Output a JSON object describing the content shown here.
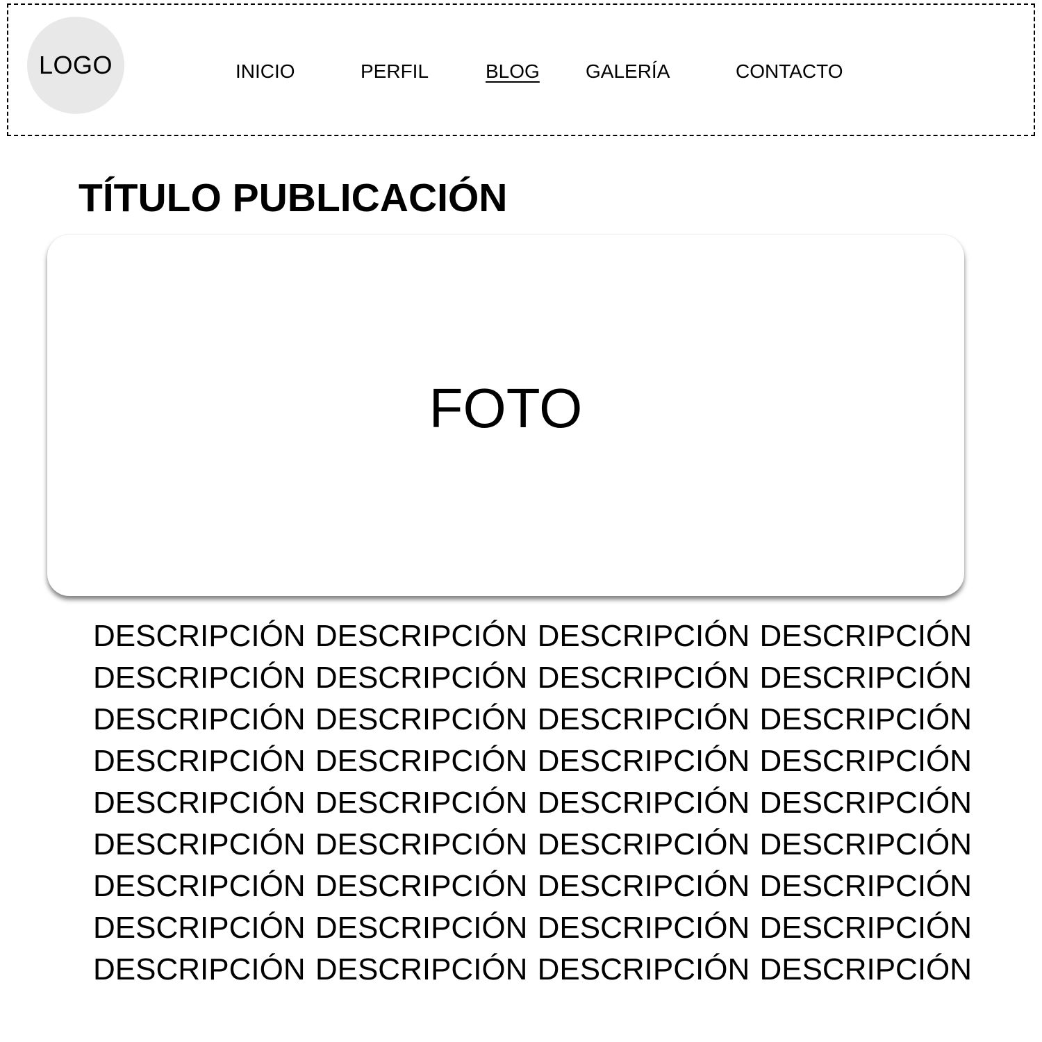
{
  "header": {
    "logo_text": "LOGO",
    "nav": [
      {
        "label": "INICIO",
        "active": false
      },
      {
        "label": "PERFIL",
        "active": false
      },
      {
        "label": "BLOG",
        "active": true
      },
      {
        "label": "GALERÍA",
        "active": false
      },
      {
        "label": "CONTACTO",
        "active": false
      }
    ]
  },
  "post": {
    "title": "TÍTULO PUBLICACIÓN",
    "photo_label": "FOTO",
    "description_lines": [
      "DESCRIPCIÓN DESCRIPCIÓN DESCRIPCIÓN DESCRIPCIÓN",
      "DESCRIPCIÓN DESCRIPCIÓN DESCRIPCIÓN DESCRIPCIÓN",
      "DESCRIPCIÓN DESCRIPCIÓN DESCRIPCIÓN DESCRIPCIÓN",
      "DESCRIPCIÓN DESCRIPCIÓN DESCRIPCIÓN DESCRIPCIÓN",
      "DESCRIPCIÓN DESCRIPCIÓN DESCRIPCIÓN DESCRIPCIÓN",
      "DESCRIPCIÓN DESCRIPCIÓN DESCRIPCIÓN DESCRIPCIÓN",
      "DESCRIPCIÓN DESCRIPCIÓN DESCRIPCIÓN DESCRIPCIÓN",
      "DESCRIPCIÓN DESCRIPCIÓN DESCRIPCIÓN DESCRIPCIÓN",
      "DESCRIPCIÓN DESCRIPCIÓN DESCRIPCIÓN DESCRIPCIÓN"
    ]
  },
  "colors": {
    "logo_fill": "#e8e8e8",
    "text": "#000000",
    "background": "#ffffff"
  }
}
